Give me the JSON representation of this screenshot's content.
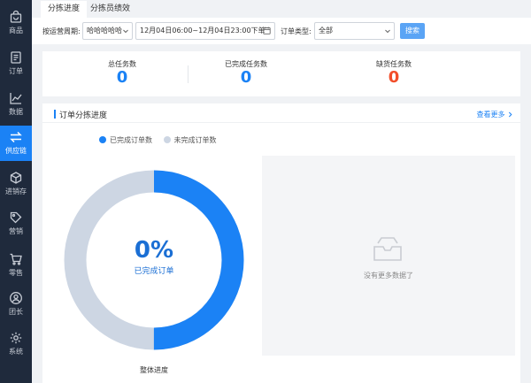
{
  "sidebar": {
    "items": [
      {
        "label": "商品",
        "icon": "bag-icon"
      },
      {
        "label": "订单",
        "icon": "document-icon"
      },
      {
        "label": "数据",
        "icon": "line-chart-icon"
      },
      {
        "label": "供应链",
        "icon": "exchange-icon",
        "active": true
      },
      {
        "label": "进销存",
        "icon": "cube-icon"
      },
      {
        "label": "营销",
        "icon": "tag-icon"
      },
      {
        "label": "零售",
        "icon": "cart-icon"
      },
      {
        "label": "团长",
        "icon": "user-icon"
      },
      {
        "label": "系统",
        "icon": "gear-icon"
      }
    ]
  },
  "tabs": [
    "分拣进度",
    "分拣员绩效"
  ],
  "filter": {
    "period_label": "按运营周期:",
    "period_value": "哈哈哈哈哈",
    "range_value": "12月04日06:00~12月04日23:00下单",
    "type_label": "订单类型:",
    "type_value": "全部",
    "search_label": "搜索"
  },
  "stats": [
    {
      "label": "总任务数",
      "value": "0",
      "color": "#1b82f5"
    },
    {
      "label": "已完成任务数",
      "value": "0",
      "color": "#1b82f5"
    },
    {
      "label": "缺货任务数",
      "value": "0",
      "color": "#f24e2a"
    }
  ],
  "progress": {
    "title": "订单分拣进度",
    "more": "查看更多",
    "legend": [
      {
        "label": "已完成订单数",
        "color": "#1b82f5"
      },
      {
        "label": "未完成订单数",
        "color": "#cdd6e3"
      }
    ],
    "percent_text": "0%",
    "percent_caption": "已完成订单",
    "footer": "整体进度",
    "completed_fraction": 0.5,
    "empty_text": "没有更多数据了"
  },
  "colors": {
    "accent": "#1b82f5",
    "sidebar_bg": "#1f2a3c",
    "danger": "#f24e2a",
    "ring_rest": "#cdd6e3"
  }
}
